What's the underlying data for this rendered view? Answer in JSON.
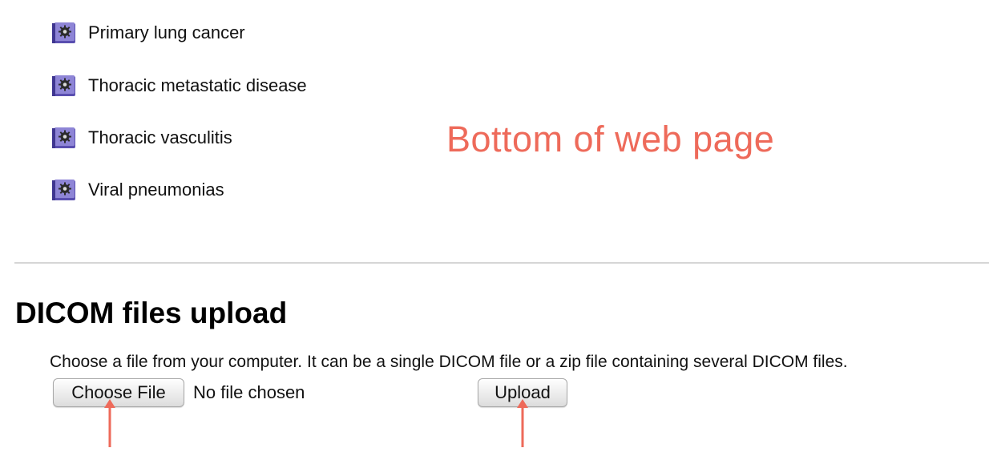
{
  "topics": [
    {
      "label": "Primary lung cancer",
      "icon": "book-gear-icon"
    },
    {
      "label": "Thoracic metastatic disease",
      "icon": "book-gear-icon"
    },
    {
      "label": "Thoracic vasculitis",
      "icon": "book-gear-icon"
    },
    {
      "label": "Viral pneumonias",
      "icon": "book-gear-icon"
    }
  ],
  "annotation": {
    "text": "Bottom of web page",
    "color": "#ee6a5a"
  },
  "upload_section": {
    "title": "DICOM files upload",
    "instructions": "Choose a file from your computer. It can be a single DICOM file or a zip file containing several DICOM files.",
    "choose_file_label": "Choose File",
    "file_status": "No file chosen",
    "upload_label": "Upload"
  },
  "colors": {
    "icon": "#7b6fc6",
    "arrow": "#ee6a5a",
    "divider": "#d6d6d6"
  }
}
